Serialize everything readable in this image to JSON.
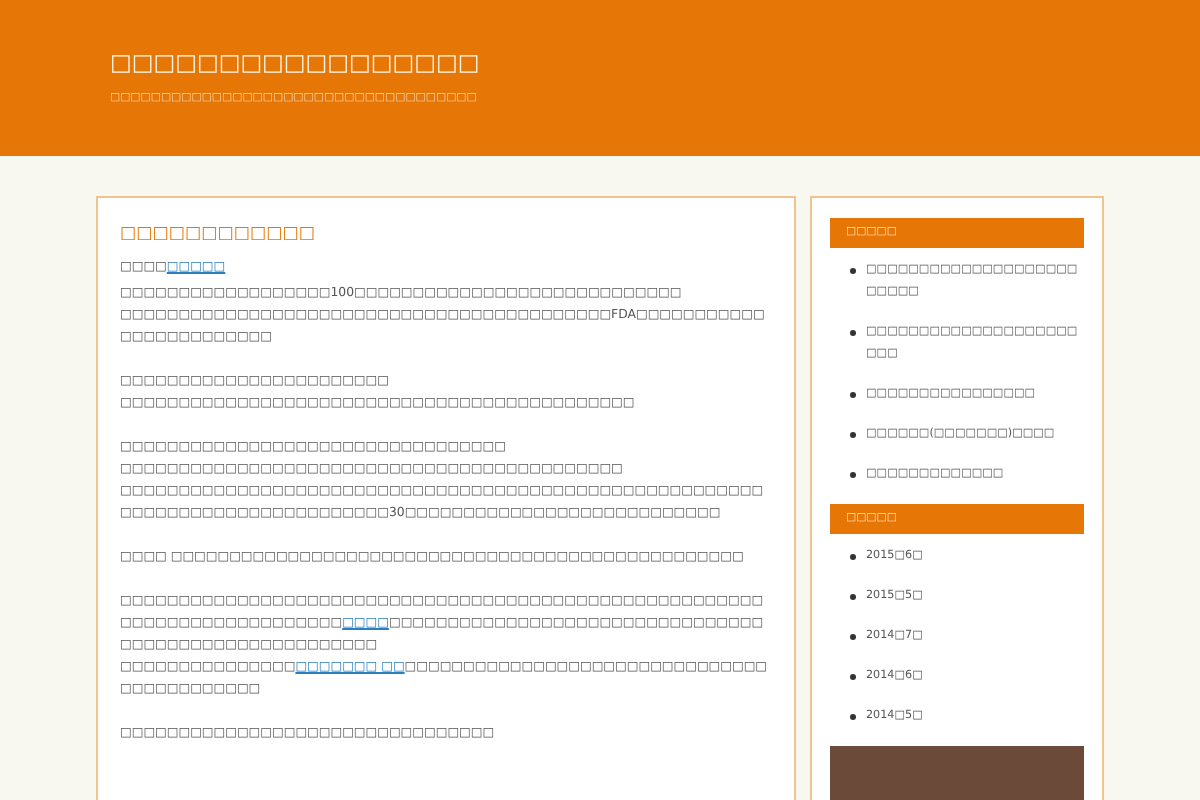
{
  "header": {
    "title": "□□□□□□□□□□□□□□□□□",
    "tagline": "□□□□□□□□□□□□□□□□□□□□□□□□□□□□□□□□□□□□"
  },
  "post": {
    "title": "□□□□□□□□□□□□",
    "meta": [
      {
        "kind": "text",
        "text": "□□□□"
      },
      {
        "kind": "link",
        "text": "□□□□□"
      }
    ],
    "paragraphs": [
      [
        [
          {
            "kind": "text",
            "text": "□□□□□□□□□□□□□□□□□□100□□□□□□□□□□□□□□□□□□□□□□□□□□□□"
          }
        ],
        [
          {
            "kind": "text",
            "text": "□□□□□□□□□□□□□□□□□□□□□□□□□□□□□□□□□□□□□□□□□□FDA□□□□□□□□□□□□□□□□□□□□□□□□"
          }
        ]
      ],
      [
        [
          {
            "kind": "text",
            "text": "□□□□□□□□□□□□□□□□□□□□□□□"
          }
        ],
        [
          {
            "kind": "text",
            "text": "□□□□□□□□□□□□□□□□□□□□□□□□□□□□□□□□□□□□□□□□□□□□"
          }
        ]
      ],
      [
        [
          {
            "kind": "text",
            "text": "□□□□□□□□□□□□□□□□□□□□□□□□□□□□□□□□□"
          }
        ],
        [
          {
            "kind": "text",
            "text": "□□□□□□□□□□□□□□□□□□□□□□□□□□□□□□□□□□□□□□□□□□□"
          }
        ],
        [
          {
            "kind": "text",
            "text": "□□□□□□□□□□□□□□□□□□□□□□□□□□□□□□□□□□□□□□□□□□□□□□□□□□□□□□□□□□□□□□□□□□□□□□□□□□□□□□30□□□□□□□□□□□□□□□□□□□□□□□□□□□"
          }
        ]
      ],
      [
        [
          {
            "kind": "text",
            "text": "□□□□ □□□□□□□□□□□□□□□□□□□□□□□□□□□□□□□□□□□□□□□□□□□□□□□□□"
          }
        ]
      ],
      [
        [
          {
            "kind": "text",
            "text": "□□□□□□□□□□□□□□□□□□□□□□□□□□□□□□□□□□□□□□□□□□□□□□□□□□□□□□□□□□□□□□□□□□□□□□□□□□"
          },
          {
            "kind": "link",
            "text": "□□□□"
          },
          {
            "kind": "text",
            "text": "□□□□□□□□□□□□□□□□□□□□□□□□□□□□□□□□□□□□□□□□□□□□□□□□□□□□□□"
          }
        ],
        [
          {
            "kind": "text",
            "text": "□□□□□□□□□□□□□□□"
          },
          {
            "kind": "link",
            "text": "□□□□□□□ □□"
          },
          {
            "kind": "text",
            "text": "□□□□□□□□□□□□□□□□□□□□□□□□□□□□□□□□□□□□□□□□□□□"
          }
        ]
      ],
      [
        [
          {
            "kind": "text",
            "text": "□□□□□□□□□□□□□□□□□□□□□□□□□□□□□□□□"
          }
        ]
      ]
    ]
  },
  "sidebar": [
    {
      "title": "□□□□□",
      "items": [
        "□□□□□□□□□□□□□□□□□□□□□□□□□",
        "□□□□□□□□□□□□□□□□□□□□□□□",
        "□□□□□□□□□□□□□□□□",
        "□□□□□□(□□□□□□□)□□□□",
        "□□□□□□□□□□□□□"
      ]
    },
    {
      "title": "□□□□□",
      "items": [
        "2015□6□",
        "2015□5□",
        "2014□7□",
        "2014□6□",
        "2014□5□"
      ]
    }
  ]
}
